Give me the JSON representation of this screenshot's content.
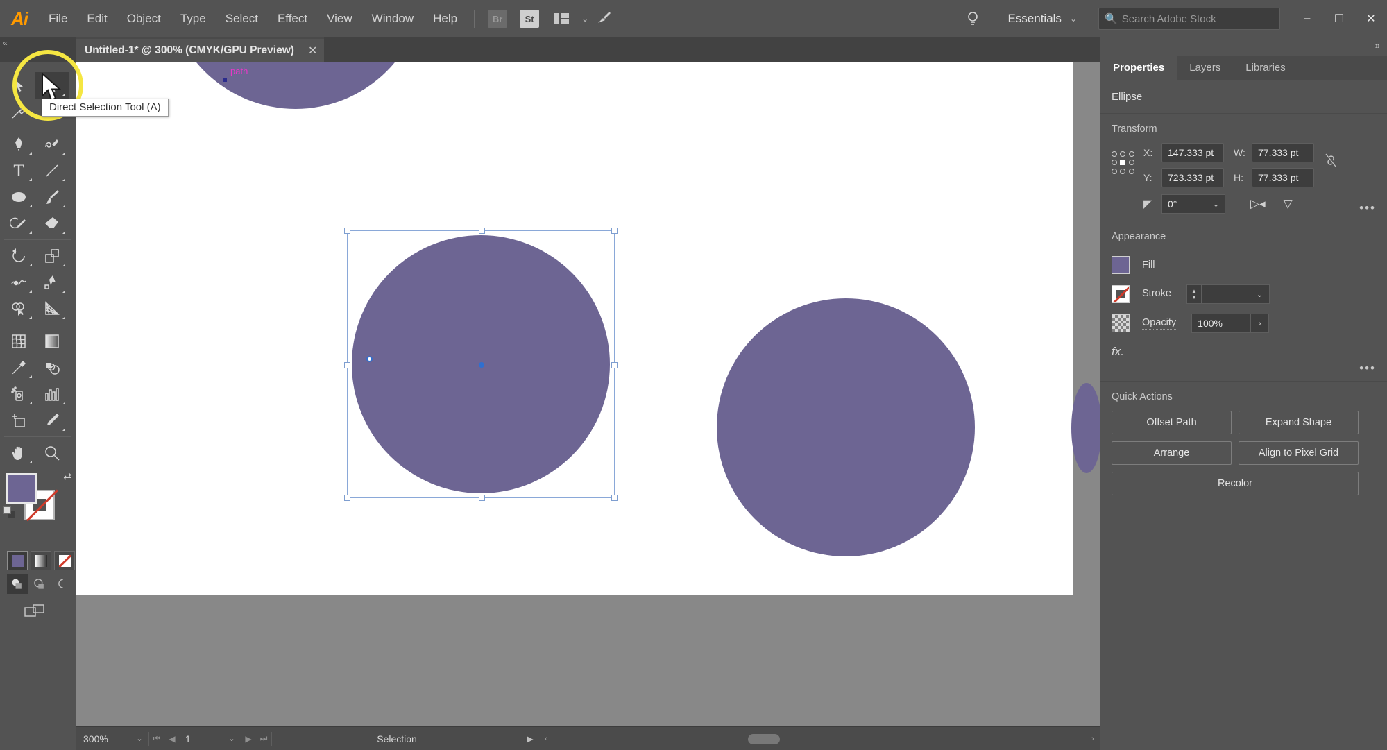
{
  "app": {
    "logo": "Ai",
    "menu_items": [
      "File",
      "Edit",
      "Object",
      "Type",
      "Select",
      "Effect",
      "View",
      "Window",
      "Help"
    ],
    "bridge_label": "Br",
    "stock_label": "St",
    "arrange_icon": "arrange-documents-icon",
    "chevron": "⌄",
    "rocket_icon": "discover-icon",
    "bulb_icon": "⚲",
    "workspace": "Essentials",
    "workspace_chevron": "⌄",
    "search": {
      "placeholder": "Search Adobe Stock",
      "icon": "search-icon"
    },
    "window_controls": {
      "minimize": "–",
      "maximize": "☐",
      "close": "✕"
    }
  },
  "document": {
    "tab_title": "Untitled-1* @ 300% (CMYK/GPU Preview)",
    "tab_close": "✕",
    "collapse": "«"
  },
  "annotation": {
    "highlight_color": "#f5e642",
    "highlight_target": "selection-tools-group"
  },
  "tooltip": {
    "text": "Direct Selection Tool (A)"
  },
  "toolbar": {
    "tools": [
      {
        "name": "selection-tool",
        "glyph": "selection-arrow",
        "selected": false,
        "has_flyout": false
      },
      {
        "name": "direct-selection-tool",
        "glyph": "direct-selection-arrow",
        "selected": true,
        "has_flyout": true
      },
      {
        "name": "magic-wand-tool",
        "glyph": "magic-wand",
        "selected": false,
        "has_flyout": false
      },
      {
        "name": "lasso-tool",
        "glyph": "lasso",
        "selected": false,
        "has_flyout": false
      },
      {
        "name": "pen-tool",
        "glyph": "pen",
        "selected": false,
        "has_flyout": true
      },
      {
        "name": "curvature-tool",
        "glyph": "curvature",
        "selected": false,
        "has_flyout": true
      },
      {
        "name": "type-tool",
        "glyph": "T",
        "selected": false,
        "has_flyout": true
      },
      {
        "name": "line-segment-tool",
        "glyph": "line",
        "selected": false,
        "has_flyout": true
      },
      {
        "name": "ellipse-tool",
        "glyph": "ellipse",
        "selected": false,
        "has_flyout": true
      },
      {
        "name": "paintbrush-tool",
        "glyph": "paintbrush",
        "selected": false,
        "has_flyout": true
      },
      {
        "name": "shaper-tool",
        "glyph": "shaper",
        "selected": false,
        "has_flyout": true
      },
      {
        "name": "eraser-tool",
        "glyph": "eraser",
        "selected": false,
        "has_flyout": true
      },
      {
        "name": "rotate-tool",
        "glyph": "rotate",
        "selected": false,
        "has_flyout": true
      },
      {
        "name": "scale-tool",
        "glyph": "scale",
        "selected": false,
        "has_flyout": true
      },
      {
        "name": "width-tool",
        "glyph": "width",
        "selected": false,
        "has_flyout": true
      },
      {
        "name": "free-transform-tool",
        "glyph": "free-transform",
        "selected": false,
        "has_flyout": true
      },
      {
        "name": "shape-builder-tool",
        "glyph": "shape-builder",
        "selected": false,
        "has_flyout": true
      },
      {
        "name": "perspective-grid-tool",
        "glyph": "perspective-grid",
        "selected": false,
        "has_flyout": true
      },
      {
        "name": "mesh-tool",
        "glyph": "mesh",
        "selected": false,
        "has_flyout": false
      },
      {
        "name": "gradient-tool",
        "glyph": "gradient",
        "selected": false,
        "has_flyout": false
      },
      {
        "name": "eyedropper-tool",
        "glyph": "eyedropper",
        "selected": false,
        "has_flyout": true
      },
      {
        "name": "blend-tool",
        "glyph": "blend",
        "selected": false,
        "has_flyout": false
      },
      {
        "name": "symbol-sprayer-tool",
        "glyph": "symbol-sprayer",
        "selected": false,
        "has_flyout": true
      },
      {
        "name": "column-graph-tool",
        "glyph": "column-graph",
        "selected": false,
        "has_flyout": true
      },
      {
        "name": "artboard-tool",
        "glyph": "artboard",
        "selected": false,
        "has_flyout": false
      },
      {
        "name": "slice-tool",
        "glyph": "slice",
        "selected": false,
        "has_flyout": true
      },
      {
        "name": "hand-tool",
        "glyph": "hand",
        "selected": false,
        "has_flyout": true
      },
      {
        "name": "zoom-tool",
        "glyph": "zoom",
        "selected": false,
        "has_flyout": false
      }
    ],
    "fill_color": "#6d6593",
    "stroke_color": "none",
    "swap_icon": "swap-fill-stroke-icon",
    "default_icon": "default-fill-stroke-icon",
    "color_modes": [
      "color",
      "gradient",
      "none"
    ],
    "active_color_mode": "color",
    "draw_modes": [
      "draw-normal",
      "draw-behind",
      "draw-inside"
    ],
    "active_draw_mode": "draw-normal",
    "screen_mode": "change-screen-mode-icon"
  },
  "canvas": {
    "background": "#888888",
    "artboard_color": "#ffffff",
    "shape_fill": "#6d6593",
    "selection_color": "#7e9ed0",
    "smart_guide_label": "path",
    "smart_guide_color": "#e838c8",
    "shapes": [
      {
        "name": "selected-ellipse",
        "type": "circle",
        "selected": true
      },
      {
        "name": "right-ellipse",
        "type": "circle",
        "selected": false
      },
      {
        "name": "top-partial-ellipse",
        "type": "circle",
        "selected": false
      },
      {
        "name": "edge-partial-ellipse",
        "type": "circle",
        "selected": false
      }
    ]
  },
  "statusbar": {
    "zoom": "300%",
    "zoom_chevron": "⌄",
    "nav_first": "⏮",
    "nav_prev": "◀",
    "page": "1",
    "page_chevron": "⌄",
    "nav_next": "▶",
    "nav_last": "⏭",
    "status_text": "Selection",
    "status_arrow": "▶",
    "scroll_left": "‹",
    "scroll_right": "›"
  },
  "panel": {
    "collapse_icon": "»",
    "tabs": [
      {
        "label": "Properties",
        "active": true
      },
      {
        "label": "Layers",
        "active": false
      },
      {
        "label": "Libraries",
        "active": false
      }
    ],
    "object_type": "Ellipse",
    "transform": {
      "title": "Transform",
      "reference_point": "center",
      "x_label": "X:",
      "x_value": "147.333 pt",
      "y_label": "Y:",
      "y_value": "723.333 pt",
      "w_label": "W:",
      "w_value": "77.333 pt",
      "h_label": "H:",
      "h_value": "77.333 pt",
      "link_icon": "constrain-proportions-unlinked-icon",
      "angle_icon": "rotate-angle-icon",
      "angle_value": "0°",
      "angle_chevron": "⌄",
      "flip_horizontal_icon": "flip-horizontal-icon",
      "flip_vertical_icon": "flip-vertical-icon",
      "more_options": "•••"
    },
    "appearance": {
      "title": "Appearance",
      "fill_label": "Fill",
      "fill_color": "#6d6593",
      "stroke_label": "Stroke",
      "stroke_color": "none",
      "stroke_weight": "",
      "stroke_chevron": "⌄",
      "opacity_label": "Opacity",
      "opacity_value": "100%",
      "opacity_arrow": "›",
      "fx_label": "fx.",
      "more_options": "•••"
    },
    "quick_actions": {
      "title": "Quick Actions",
      "buttons": [
        {
          "label": "Offset Path",
          "wide": false
        },
        {
          "label": "Expand Shape",
          "wide": false
        },
        {
          "label": "Arrange",
          "wide": false
        },
        {
          "label": "Align to Pixel Grid",
          "wide": false
        },
        {
          "label": "Recolor",
          "wide": true
        }
      ]
    }
  }
}
